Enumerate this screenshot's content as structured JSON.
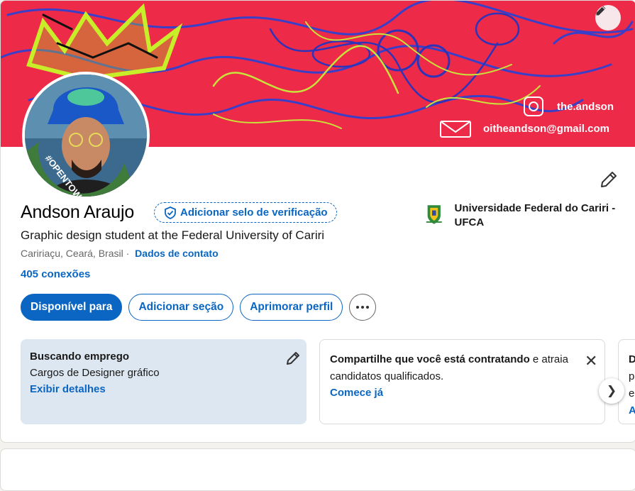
{
  "banner": {
    "handle": "the.andson",
    "email": "oitheandson@gmail.com",
    "edit_icon": "pencil-icon"
  },
  "profile": {
    "name": "Andson Araujo",
    "verify_label": "Adicionar selo de verificação",
    "headline": "Graphic design student at the Federal University of Cariri",
    "location": "Caririaçu, Ceará, Brasil",
    "contact_label": "Dados de contato",
    "connections": "405 conexões",
    "open_to_work_badge": "#OPENTOWORK"
  },
  "education": {
    "name": "Universidade Federal do Cariri - UFCA"
  },
  "actions": {
    "available": "Disponível para",
    "add_section": "Adicionar seção",
    "improve": "Aprimorar perfil"
  },
  "job_panel": {
    "title": "Buscando emprego",
    "subtitle": "Cargos de Designer gráfico",
    "link": "Exibir detalhes"
  },
  "hire_panel": {
    "text_bold": "Compartilhe que você está contratando",
    "text_rest": " e atraia candidatos qualificados.",
    "link": "Comece já"
  },
  "third_panel": {
    "line1": "D",
    "line2": "p",
    "line3": "e",
    "line4": "A"
  },
  "colors": {
    "accent": "#0a66c2",
    "banner": "#ee2a49",
    "panel": "#dde7f1"
  }
}
